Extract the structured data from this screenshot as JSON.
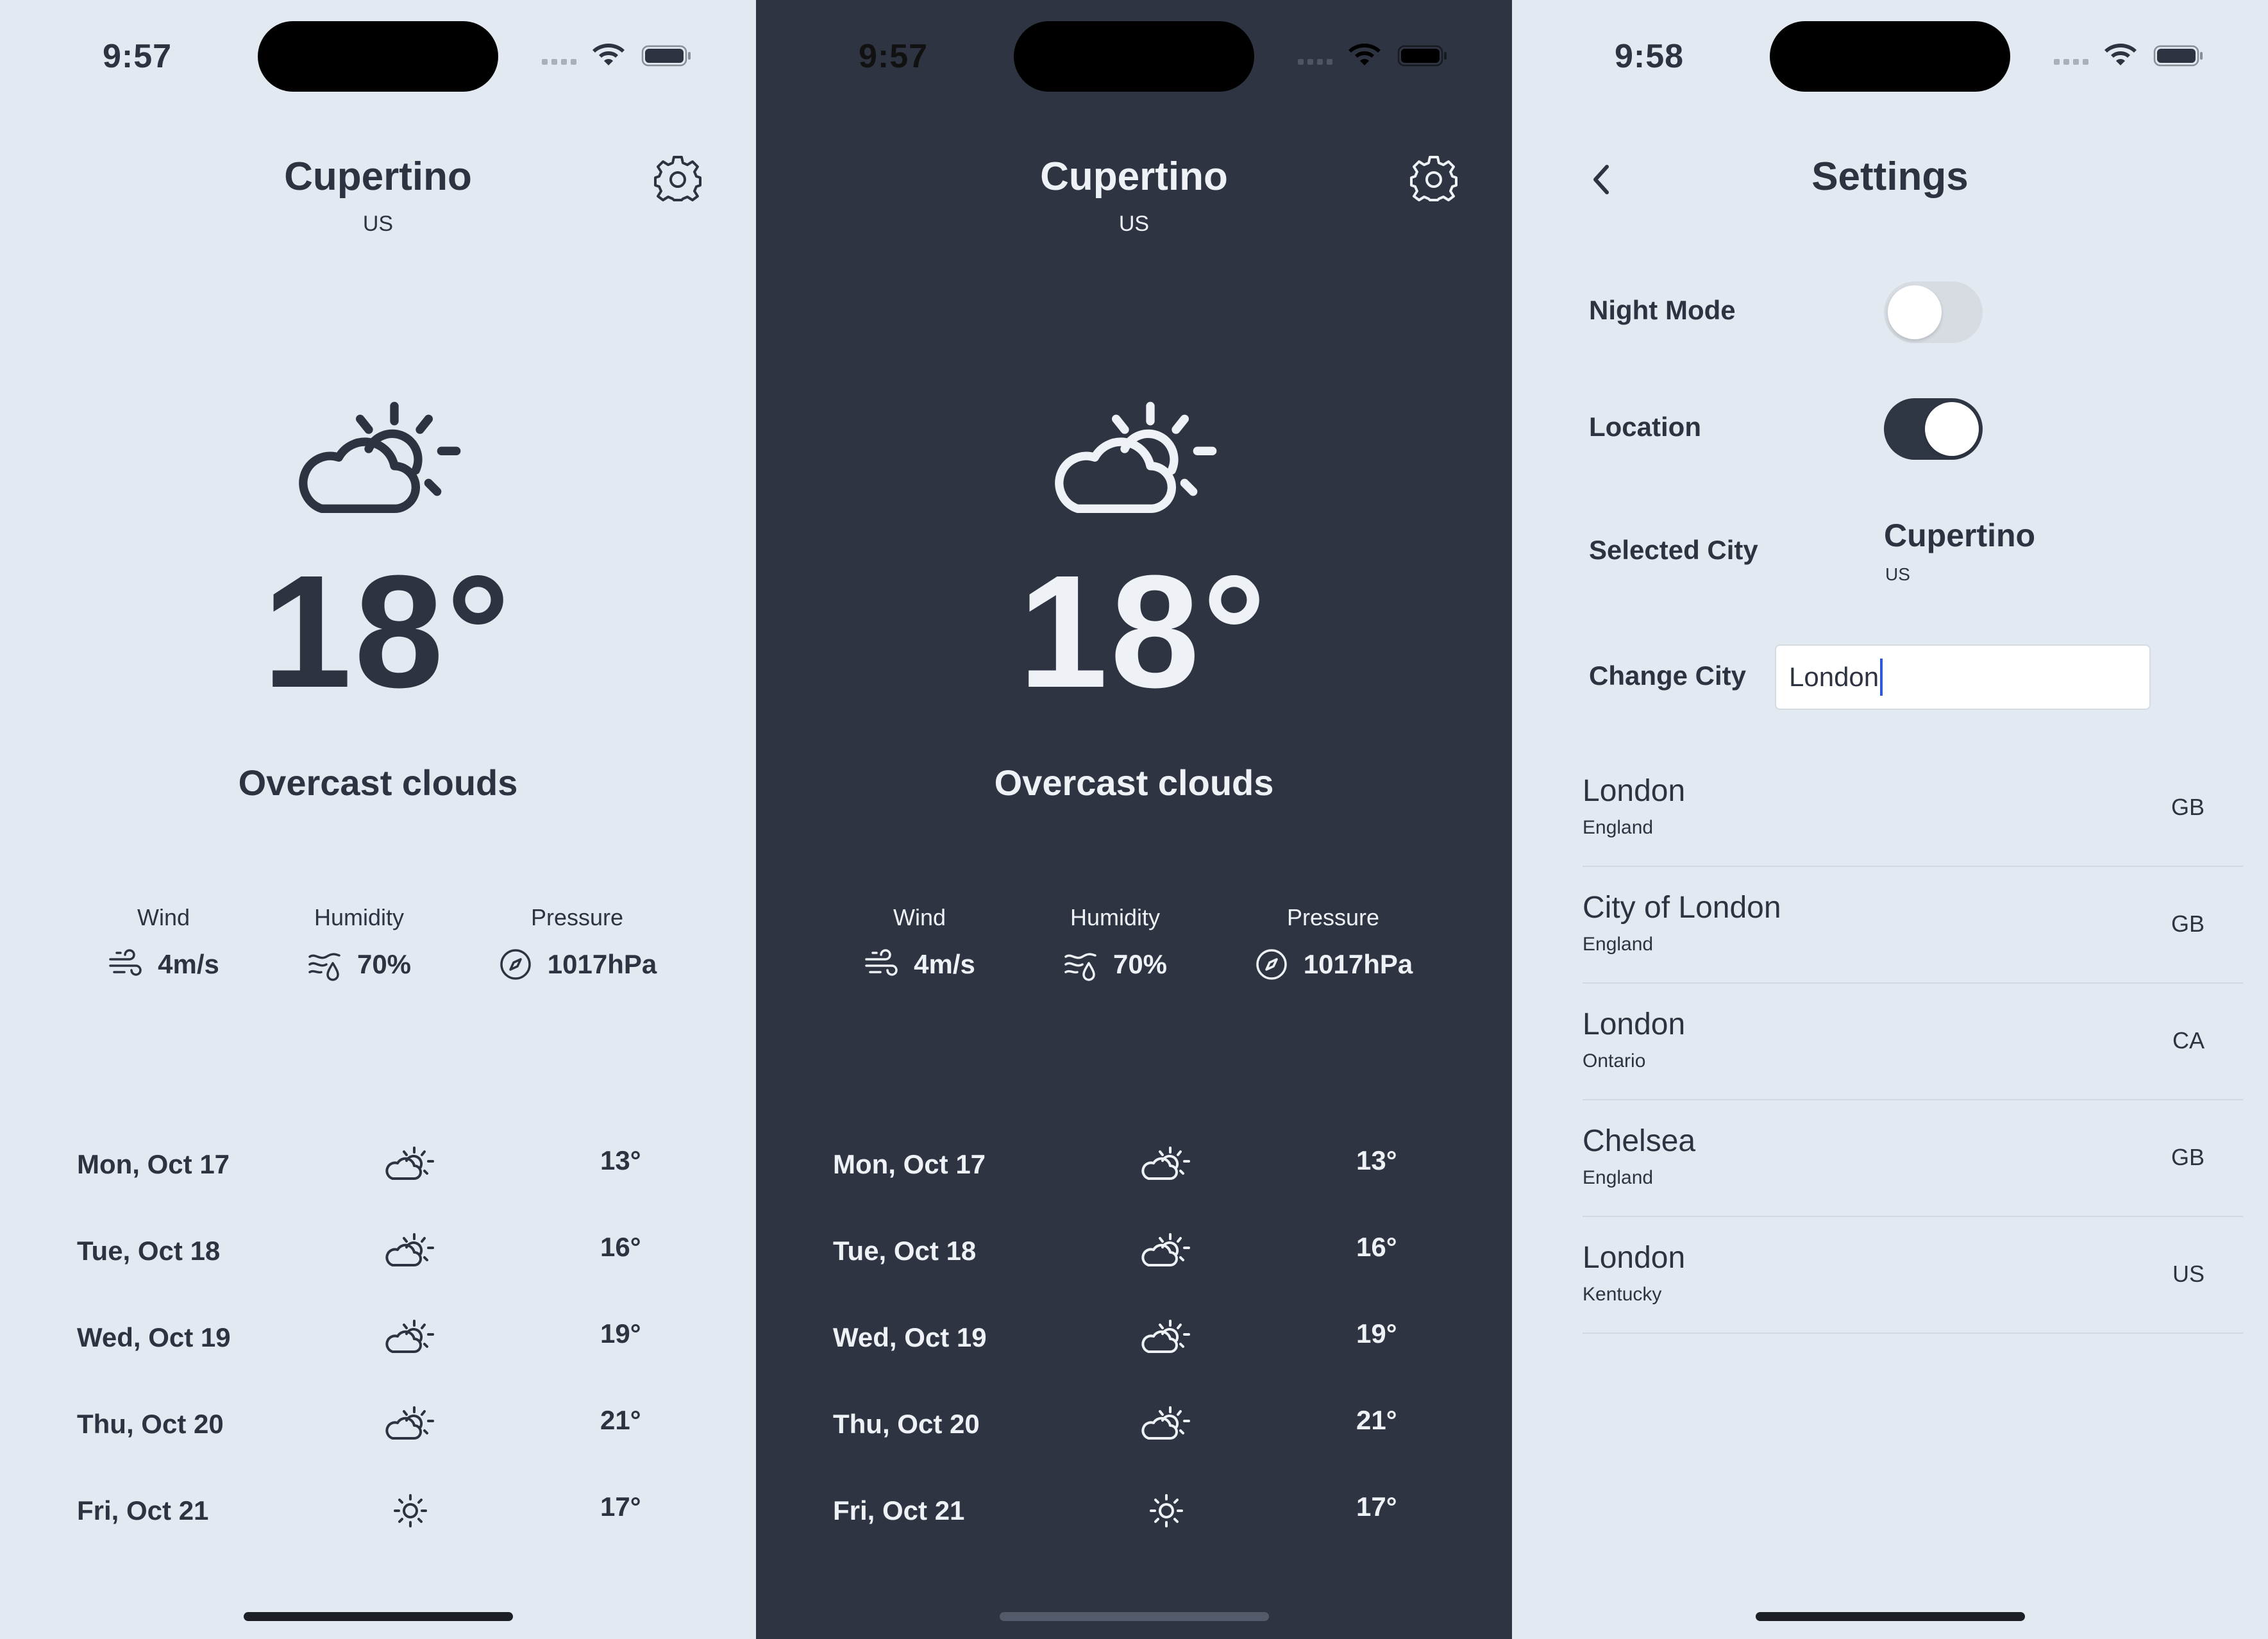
{
  "colors": {
    "light_bg": "#e3e9f1",
    "dark_bg": "#2e3442",
    "text_dark": "#2d3340",
    "text_light": "#eef1f5",
    "toggle_on": "#2f3644",
    "caret": "#2f58d8"
  },
  "screens": [
    {
      "theme": "light",
      "status_time": "9:57",
      "city": "Cupertino",
      "country": "US",
      "temperature": "18°",
      "condition": "Overcast clouds",
      "stats": {
        "wind": {
          "label": "Wind",
          "value": "4m/s",
          "icon": "wind-icon"
        },
        "humidity": {
          "label": "Humidity",
          "value": "70%",
          "icon": "humidity-icon"
        },
        "pressure": {
          "label": "Pressure",
          "value": "1017hPa",
          "icon": "compass-icon"
        }
      },
      "forecast": [
        {
          "day": "Mon, Oct 17",
          "icon": "partly-cloudy-icon",
          "temp": "13°"
        },
        {
          "day": "Tue, Oct 18",
          "icon": "partly-cloudy-icon",
          "temp": "16°"
        },
        {
          "day": "Wed, Oct 19",
          "icon": "partly-cloudy-icon",
          "temp": "19°"
        },
        {
          "day": "Thu, Oct 20",
          "icon": "partly-cloudy-icon",
          "temp": "21°"
        },
        {
          "day": "Fri, Oct 21",
          "icon": "sun-icon",
          "temp": "17°"
        }
      ]
    },
    {
      "theme": "dark",
      "status_time": "9:57",
      "city": "Cupertino",
      "country": "US",
      "temperature": "18°",
      "condition": "Overcast clouds",
      "stats": {
        "wind": {
          "label": "Wind",
          "value": "4m/s",
          "icon": "wind-icon"
        },
        "humidity": {
          "label": "Humidity",
          "value": "70%",
          "icon": "humidity-icon"
        },
        "pressure": {
          "label": "Pressure",
          "value": "1017hPa",
          "icon": "compass-icon"
        }
      },
      "forecast": [
        {
          "day": "Mon, Oct 17",
          "icon": "partly-cloudy-icon",
          "temp": "13°"
        },
        {
          "day": "Tue, Oct 18",
          "icon": "partly-cloudy-icon",
          "temp": "16°"
        },
        {
          "day": "Wed, Oct 19",
          "icon": "partly-cloudy-icon",
          "temp": "19°"
        },
        {
          "day": "Thu, Oct 20",
          "icon": "partly-cloudy-icon",
          "temp": "21°"
        },
        {
          "day": "Fri, Oct 21",
          "icon": "sun-icon",
          "temp": "17°"
        }
      ]
    }
  ],
  "settings": {
    "status_time": "9:58",
    "title": "Settings",
    "night_mode": {
      "label": "Night Mode",
      "enabled": false
    },
    "location": {
      "label": "Location",
      "enabled": true
    },
    "selected_city": {
      "label": "Selected City",
      "city": "Cupertino",
      "country": "US"
    },
    "change_city": {
      "label": "Change City",
      "value": "London"
    },
    "results": [
      {
        "city": "London",
        "region": "England",
        "code": "GB"
      },
      {
        "city": "City of London",
        "region": "England",
        "code": "GB"
      },
      {
        "city": "London",
        "region": "Ontario",
        "code": "CA"
      },
      {
        "city": "Chelsea",
        "region": "England",
        "code": "GB"
      },
      {
        "city": "London",
        "region": "Kentucky",
        "code": "US"
      }
    ]
  }
}
